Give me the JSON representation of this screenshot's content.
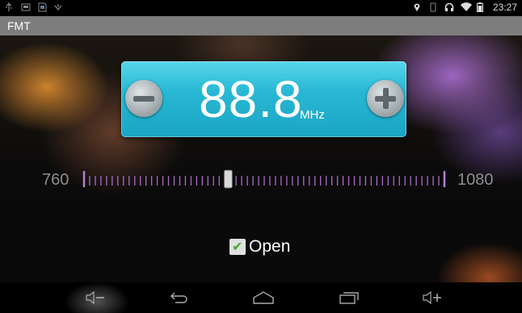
{
  "status_bar": {
    "time": "23:27",
    "left_icons": [
      "usb-icon",
      "screenshot-icon",
      "sd-icon",
      "android-debug-icon"
    ],
    "right_icons": [
      "location-icon",
      "vibrate-icon",
      "headphones-icon",
      "wifi-icon",
      "battery-icon"
    ]
  },
  "app": {
    "title": "FMT"
  },
  "tuner": {
    "frequency": "88.8",
    "unit": "MHz",
    "scale_min": "760",
    "scale_max": "1080",
    "slider_value": 888
  },
  "open_option": {
    "label": "Open",
    "checked": true
  },
  "navbar": {
    "buttons": [
      "volume-down-icon",
      "back-icon",
      "home-icon",
      "recents-icon",
      "volume-up-icon"
    ]
  },
  "colors": {
    "title_bar": "#7d7d7d",
    "freq_panel": "#28b8d4",
    "tick": "#a86bc8",
    "check": "#43a82a"
  }
}
